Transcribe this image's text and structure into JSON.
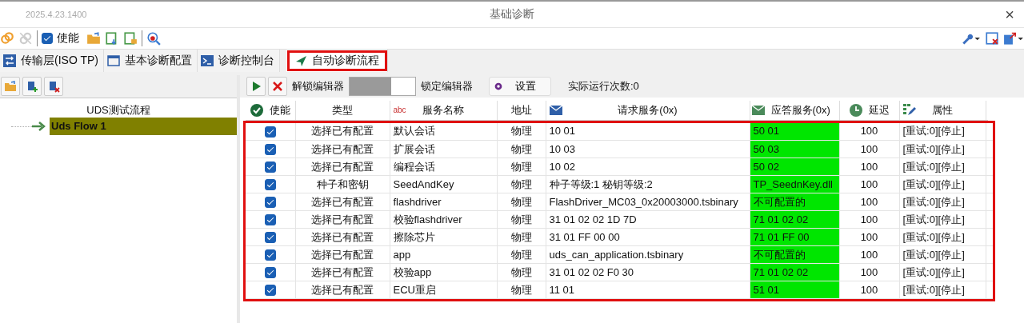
{
  "window": {
    "version": "2025.4.23.1400",
    "title": "基础诊断",
    "close": "×"
  },
  "toolbar": {
    "enable_checkbox": {
      "label": "使能",
      "checked": true
    }
  },
  "tabs": [
    {
      "label": "传输层(ISO TP)",
      "selected": false
    },
    {
      "label": "基本诊断配置",
      "selected": false
    },
    {
      "label": "诊断控制台",
      "selected": false
    },
    {
      "label": "自动诊断流程",
      "selected": true
    }
  ],
  "tree": {
    "header": "UDS测试流程",
    "items": [
      {
        "label": "Uds Flow 1",
        "selected": true
      }
    ]
  },
  "editor_bar": {
    "unlock_label": "解锁编辑器",
    "locked": true,
    "lock_label": "锁定编辑器",
    "settings": "设置",
    "run_count": "实际运行次数:0"
  },
  "table": {
    "text_type_badge": "abc",
    "columns": [
      "使能",
      "类型",
      "服务名称",
      "地址",
      "请求服务(0x)",
      "应答服务(0x)",
      "延迟",
      "属性"
    ],
    "rows": [
      {
        "enabled": true,
        "type": "选择已有配置",
        "name": "默认会话",
        "address": "物理",
        "request": "10 01",
        "response": "50 01",
        "delay": "100",
        "attributes": "[重试:0][停止]"
      },
      {
        "enabled": true,
        "type": "选择已有配置",
        "name": "扩展会话",
        "address": "物理",
        "request": "10 03",
        "response": "50 03",
        "delay": "100",
        "attributes": "[重试:0][停止]"
      },
      {
        "enabled": true,
        "type": "选择已有配置",
        "name": "编程会话",
        "address": "物理",
        "request": "10 02",
        "response": "50 02",
        "delay": "100",
        "attributes": "[重试:0][停止]"
      },
      {
        "enabled": true,
        "type": "种子和密钥",
        "name": "SeedAndKey",
        "address": "物理",
        "request": "种子等级:1 秘钥等级:2",
        "response": "TP_SeednKey.dll",
        "delay": "100",
        "attributes": "[重试:0][停止]"
      },
      {
        "enabled": true,
        "type": "选择已有配置",
        "name": "flashdriver",
        "address": "物理",
        "request": "FlashDriver_MC03_0x20003000.tsbinary",
        "response": "不可配置的",
        "delay": "100",
        "attributes": "[重试:0][停止]"
      },
      {
        "enabled": true,
        "type": "选择已有配置",
        "name": "校验flashdriver",
        "address": "物理",
        "request": "31 01 02 02 1D 7D",
        "response": "71 01 02 02",
        "delay": "100",
        "attributes": "[重试:0][停止]"
      },
      {
        "enabled": true,
        "type": "选择已有配置",
        "name": "擦除芯片",
        "address": "物理",
        "request": "31 01 FF 00 00",
        "response": "71 01 FF 00",
        "delay": "100",
        "attributes": "[重试:0][停止]"
      },
      {
        "enabled": true,
        "type": "选择已有配置",
        "name": "app",
        "address": "物理",
        "request": "uds_can_application.tsbinary",
        "response": "不可配置的",
        "delay": "100",
        "attributes": "[重试:0][停止]"
      },
      {
        "enabled": true,
        "type": "选择已有配置",
        "name": "校验app",
        "address": "物理",
        "request": "31 01 02 02 F0 30",
        "response": "71 01 02 02",
        "delay": "100",
        "attributes": "[重试:0][停止]"
      },
      {
        "enabled": true,
        "type": "选择已有配置",
        "name": "ECU重启",
        "address": "物理",
        "request": "11 01",
        "response": "51 01",
        "delay": "100",
        "attributes": "[重试:0][停止]"
      }
    ]
  }
}
